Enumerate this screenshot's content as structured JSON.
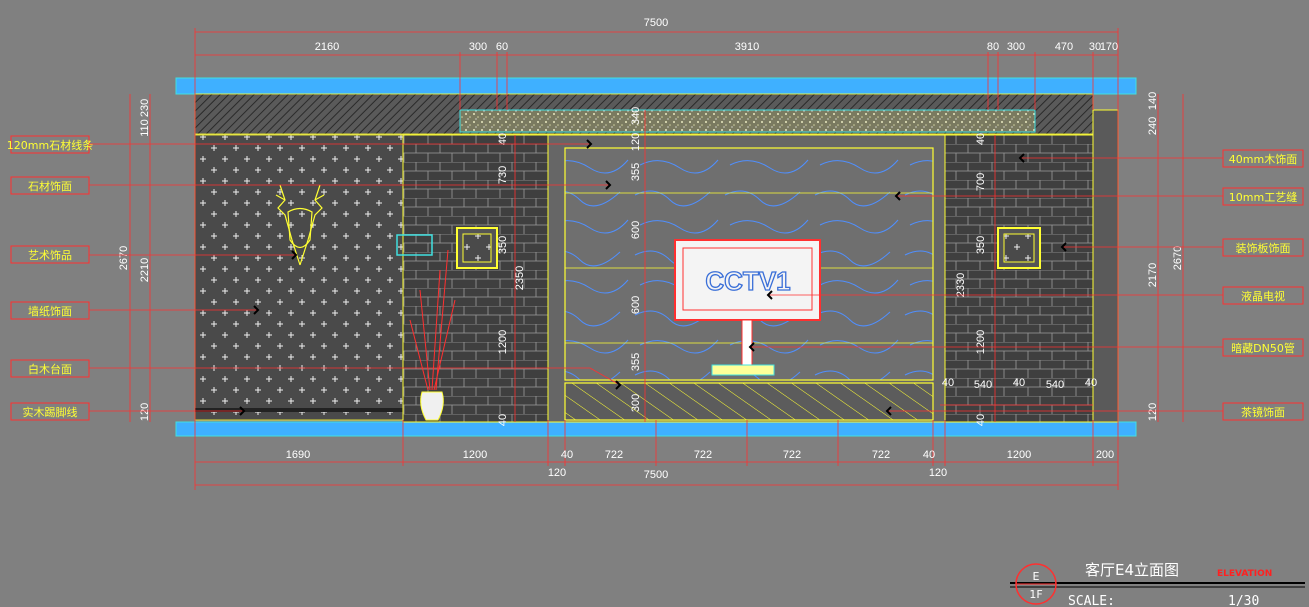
{
  "dimensions": {
    "top_total": "7500",
    "top_segments": [
      "2160",
      "300",
      "60",
      "3910",
      "80",
      "300",
      "470",
      "30",
      "170"
    ],
    "bottom_segments": [
      "1690",
      "1200",
      "40",
      "722",
      "722",
      "722",
      "722",
      "40",
      "1200",
      "200"
    ],
    "bottom_total": "7500",
    "bottom_small": [
      "120",
      "120"
    ],
    "left_vertical": [
      "110",
      "230",
      "2210",
      "120"
    ],
    "left_total": "2670",
    "right_vertical": [
      "140",
      "240",
      "2170",
      "120"
    ],
    "right_total": "2670",
    "inner_left": [
      "40",
      "120",
      "730",
      "350",
      "2350",
      "1200",
      "40"
    ],
    "center_vertical": [
      "340",
      "120",
      "355",
      "600",
      "600",
      "355",
      "300"
    ],
    "inner_right": [
      "40",
      "700",
      "350",
      "2330",
      "1200",
      "40"
    ],
    "lower_right": [
      "40",
      "540",
      "40",
      "540",
      "40"
    ]
  },
  "callouts_left": [
    {
      "text": "120mm石材线条"
    },
    {
      "text": "石材饰面"
    },
    {
      "text": "艺术饰品"
    },
    {
      "text": "墙纸饰面"
    },
    {
      "text": "白木台面"
    },
    {
      "text": "实木踢脚线"
    }
  ],
  "callouts_right": [
    {
      "text": "40mm木饰面"
    },
    {
      "text": "10mm工艺缝"
    },
    {
      "text": "装饰板饰面"
    },
    {
      "text": "液晶电视"
    },
    {
      "text": "暗藏DN50管"
    },
    {
      "text": "茶镜饰面"
    }
  ],
  "tv_logo": "CCTV1",
  "title_block": {
    "title": "客厅E4立面图",
    "subtitle": "ELEVATION",
    "scale_label": "SCALE:",
    "scale_value": "1/30",
    "marker_top": "E",
    "marker_bottom": "1F"
  },
  "colors": {
    "background": "#808080",
    "dim_line": "#ff3030",
    "outline": "#ffff33",
    "cyan": "#40e0e0",
    "band": "#3fb0ff",
    "label_box": "#ff3030"
  }
}
